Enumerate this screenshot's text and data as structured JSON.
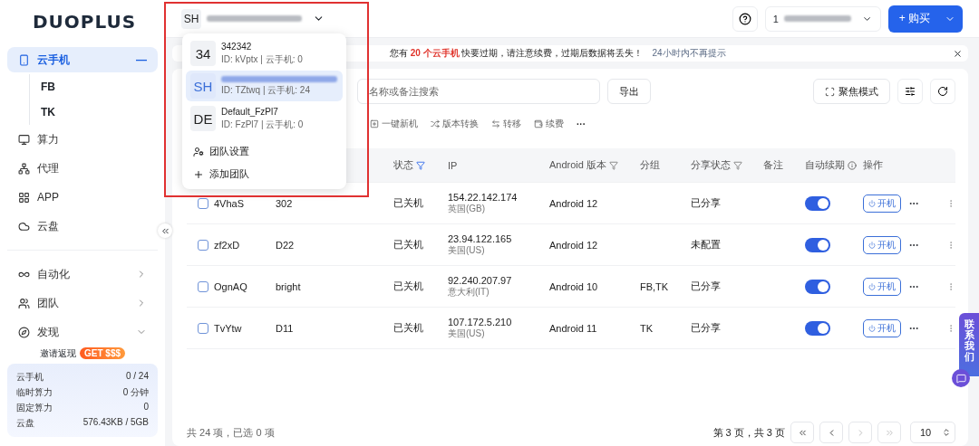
{
  "logo": "DUOPLUS",
  "team_switcher": {
    "avatar": "SH"
  },
  "team_menu": {
    "teams": [
      {
        "avatar": "34",
        "name": "342342",
        "meta": "ID: kVptx | 云手机: 0",
        "selected": false,
        "name_blurred": false
      },
      {
        "avatar": "SH",
        "meta": "ID: TZtwq | 云手机: 24",
        "selected": true,
        "name_blurred": true
      },
      {
        "avatar": "DE",
        "name": "Default_FzPl7",
        "meta": "ID: FzPl7 | 云手机: 0",
        "selected": false,
        "name_blurred": false
      }
    ],
    "actions": [
      {
        "kind": "settings",
        "label": "团队设置"
      },
      {
        "kind": "add",
        "label": "添加团队"
      }
    ]
  },
  "header": {
    "account": "1",
    "buy_button": "+ 购买"
  },
  "sidebar": {
    "items": [
      {
        "kind": "phone",
        "label": "云手机",
        "selected": true,
        "expander": "—",
        "children": [
          {
            "label": "FB"
          },
          {
            "label": "TK"
          }
        ]
      },
      {
        "kind": "compute",
        "label": "算力",
        "selected": false
      },
      {
        "kind": "proxy",
        "label": "代理",
        "selected": false
      },
      {
        "kind": "app",
        "label": "APP",
        "selected": false
      },
      {
        "kind": "cloud",
        "label": "云盘",
        "selected": false
      }
    ],
    "groups": [
      {
        "kind": "automation",
        "label": "自动化",
        "expanded": false
      },
      {
        "kind": "team",
        "label": "团队",
        "expanded": false
      },
      {
        "kind": "discover",
        "label": "发现",
        "expanded": true
      }
    ],
    "promo": {
      "label": "邀请返现",
      "badge": "GET $$$"
    },
    "stats": [
      {
        "label": "云手机",
        "value": "0 / 24"
      },
      {
        "label": "临时算力",
        "value": "0 分钟"
      },
      {
        "label": "固定算力",
        "value": "0"
      },
      {
        "label": "云盘",
        "value": "576.43KB / 5GB"
      }
    ]
  },
  "banner": {
    "text": "您有 **20 个云手机** 快要过期，请注意续费，过期后数据将丢失！",
    "dismiss": "24小时内不再提示"
  },
  "search": {
    "placeholder": "名称或备注搜索"
  },
  "toolbar": {
    "export": "导出",
    "focus": "聚焦模式",
    "actions": [
      {
        "kind": "new",
        "label": "一键新机"
      },
      {
        "kind": "convert",
        "label": "版本转换"
      },
      {
        "kind": "transfer",
        "label": "转移"
      },
      {
        "kind": "renew",
        "label": "续费"
      }
    ],
    "more": "···"
  },
  "table": {
    "columns": [
      {
        "label": "状态",
        "filter": true
      },
      {
        "label": "IP",
        "filter": false
      },
      {
        "label": "Android 版本",
        "filter": true
      },
      {
        "label": "分组",
        "filter": false
      },
      {
        "label": "分享状态",
        "filter": true
      },
      {
        "label": "备注",
        "filter": false
      },
      {
        "label": "自动续期",
        "filter": false
      },
      {
        "label": "操作",
        "filter": false
      }
    ],
    "rows": [
      {
        "checked": false,
        "id": "4VhaS",
        "name": "302",
        "status": "已关机",
        "ip": "154.22.142.174",
        "region": "英国(GB)",
        "android": "Android 12",
        "share": "已分享",
        "auto_renew": true,
        "action": "开机"
      },
      {
        "checked": false,
        "id": "zf2xD",
        "name": "D22",
        "status": "已关机",
        "ip": "23.94.122.165",
        "region": "美国(US)",
        "android": "Android 12",
        "share": "未配置",
        "auto_renew": true,
        "action": "开机"
      },
      {
        "checked": false,
        "id": "OgnAQ",
        "name": "bright",
        "status": "已关机",
        "ip": "92.240.207.97",
        "region": "意大利(IT)",
        "android": "Android 10",
        "group": "FB,TK",
        "share": "已分享",
        "auto_renew": true,
        "action": "开机"
      },
      {
        "checked": false,
        "id": "TvYtw",
        "name": "D11",
        "status": "已关机",
        "ip": "107.172.5.210",
        "region": "美国(US)",
        "android": "Android 11",
        "group": "TK",
        "share": "已分享",
        "auto_renew": true,
        "action": "开机"
      }
    ]
  },
  "footer": {
    "summary": "共 24 项，已选 0 项",
    "pages": "第 3 页，共 3 页",
    "page_size": "10"
  },
  "contact_tab": "联系我们"
}
